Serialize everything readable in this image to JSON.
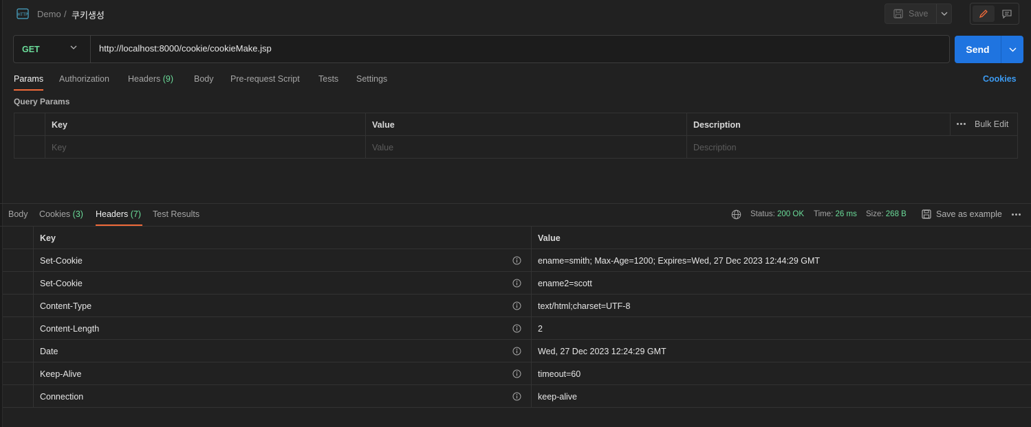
{
  "breadcrumb": {
    "workspace": "Demo",
    "separator": "/",
    "request_name": "쿠키생성"
  },
  "toolbar": {
    "save_label": "Save"
  },
  "request": {
    "method": "GET",
    "url": "http://localhost:8000/cookie/cookieMake.jsp",
    "send_label": "Send"
  },
  "request_tabs": {
    "params": "Params",
    "authorization": "Authorization",
    "headers": "Headers",
    "headers_count": "(9)",
    "body": "Body",
    "prerequest": "Pre-request Script",
    "tests": "Tests",
    "settings": "Settings",
    "cookies_link": "Cookies"
  },
  "query_params": {
    "section_label": "Query Params",
    "columns": {
      "key": "Key",
      "value": "Value",
      "description": "Description"
    },
    "bulk_edit": "Bulk Edit",
    "placeholders": {
      "key": "Key",
      "value": "Value",
      "description": "Description"
    }
  },
  "response_tabs": {
    "body": "Body",
    "cookies": "Cookies",
    "cookies_count": "(3)",
    "headers": "Headers",
    "headers_count": "(7)",
    "test_results": "Test Results"
  },
  "response_meta": {
    "status_label": "Status:",
    "status_value": "200 OK",
    "time_label": "Time:",
    "time_value": "26 ms",
    "size_label": "Size:",
    "size_value": "268 B",
    "save_example": "Save as example"
  },
  "response_headers": {
    "columns": {
      "key": "Key",
      "value": "Value"
    },
    "rows": [
      {
        "key": "Set-Cookie",
        "value": "ename=smith; Max-Age=1200; Expires=Wed, 27 Dec 2023 12:44:29 GMT"
      },
      {
        "key": "Set-Cookie",
        "value": "ename2=scott"
      },
      {
        "key": "Content-Type",
        "value": "text/html;charset=UTF-8"
      },
      {
        "key": "Content-Length",
        "value": "2"
      },
      {
        "key": "Date",
        "value": "Wed, 27 Dec 2023 12:24:29 GMT"
      },
      {
        "key": "Keep-Alive",
        "value": "timeout=60"
      },
      {
        "key": "Connection",
        "value": "keep-alive"
      }
    ]
  },
  "colors": {
    "background": "#212121",
    "accent_orange": "#f26b3a",
    "send_blue": "#1f74e0",
    "method_green": "#6bdd9a",
    "link_blue": "#3c9bf2"
  },
  "icons": {
    "http": "http-icon",
    "save": "floppy-disk-icon",
    "edit": "pencil-icon",
    "comment": "comment-icon",
    "globe": "globe-icon",
    "info": "info-icon",
    "more": "more-horizontal-icon",
    "caret": "chevron-down-icon"
  }
}
